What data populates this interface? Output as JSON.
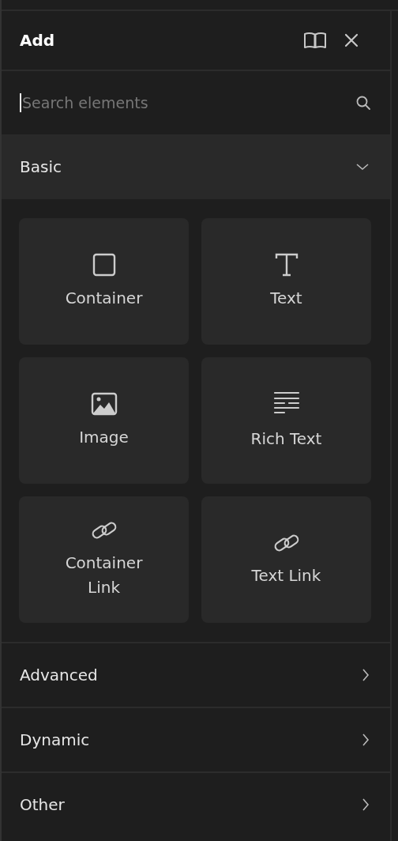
{
  "panel": {
    "title": "Add"
  },
  "search": {
    "placeholder": "Search elements"
  },
  "sections": [
    {
      "label": "Basic",
      "expanded": true,
      "items": [
        {
          "label": "Container",
          "kind": "box"
        },
        {
          "label": "Text",
          "kind": "text"
        },
        {
          "label": "Image",
          "kind": "image"
        },
        {
          "label": "Rich Text",
          "kind": "richtext"
        },
        {
          "label": "Container Link",
          "kind": "link"
        },
        {
          "label": "Text Link",
          "kind": "link"
        }
      ]
    },
    {
      "label": "Advanced",
      "expanded": false
    },
    {
      "label": "Dynamic",
      "expanded": false
    },
    {
      "label": "Other",
      "expanded": false
    }
  ]
}
